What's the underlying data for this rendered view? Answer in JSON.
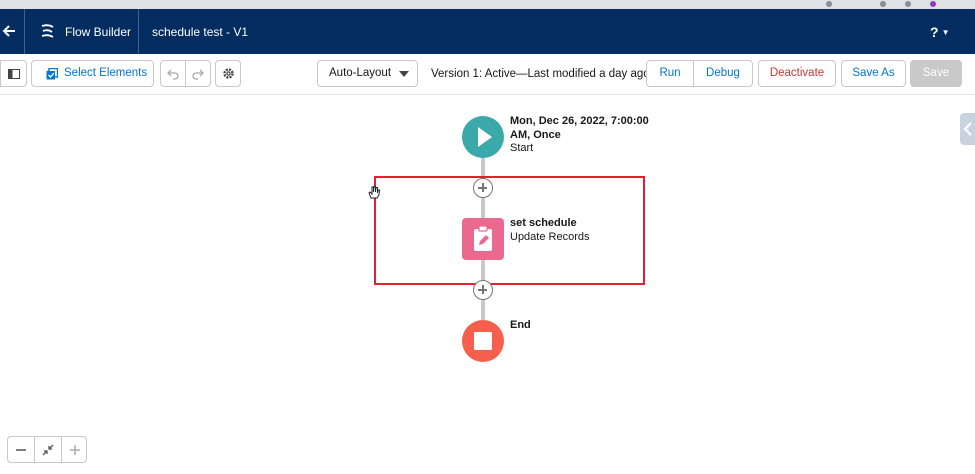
{
  "header": {
    "app_name": "Flow Builder",
    "flow_title": "schedule test - V1",
    "help_label": "?"
  },
  "toolbar": {
    "select_elements_label": "Select Elements",
    "layout_select_value": "Auto-Layout",
    "version_status": "Version 1: Active—Last modified a day ago",
    "run_label": "Run",
    "debug_label": "Debug",
    "deactivate_label": "Deactivate",
    "save_as_label": "Save As",
    "save_label": "Save"
  },
  "canvas": {
    "start_node": {
      "title_line1": "Mon, Dec 26, 2022, 7:00:00",
      "title_line2": "AM, Once",
      "subtitle": "Start"
    },
    "update_node": {
      "title": "set schedule",
      "subtitle": "Update Records"
    },
    "end_node": {
      "title": "End"
    }
  },
  "colors": {
    "header_bg": "#032d60",
    "start_node": "#3ba9a9",
    "update_node": "#e9698f",
    "end_node": "#f65f4d",
    "highlight_border": "#e0222e",
    "deactivate_text": "#c23934",
    "link_blue": "#0176d3"
  },
  "icons": {
    "back": "arrow-left-icon",
    "app": "flow-icon",
    "panel": "panel-toggle-icon",
    "select": "select-elements-icon",
    "undo": "undo-icon",
    "redo": "redo-icon",
    "settings": "gear-icon",
    "start": "play-icon",
    "update": "clipboard-edit-icon",
    "end": "stop-icon",
    "zoom_out": "minus-icon",
    "fit": "fit-view-icon",
    "zoom_in": "plus-icon"
  }
}
